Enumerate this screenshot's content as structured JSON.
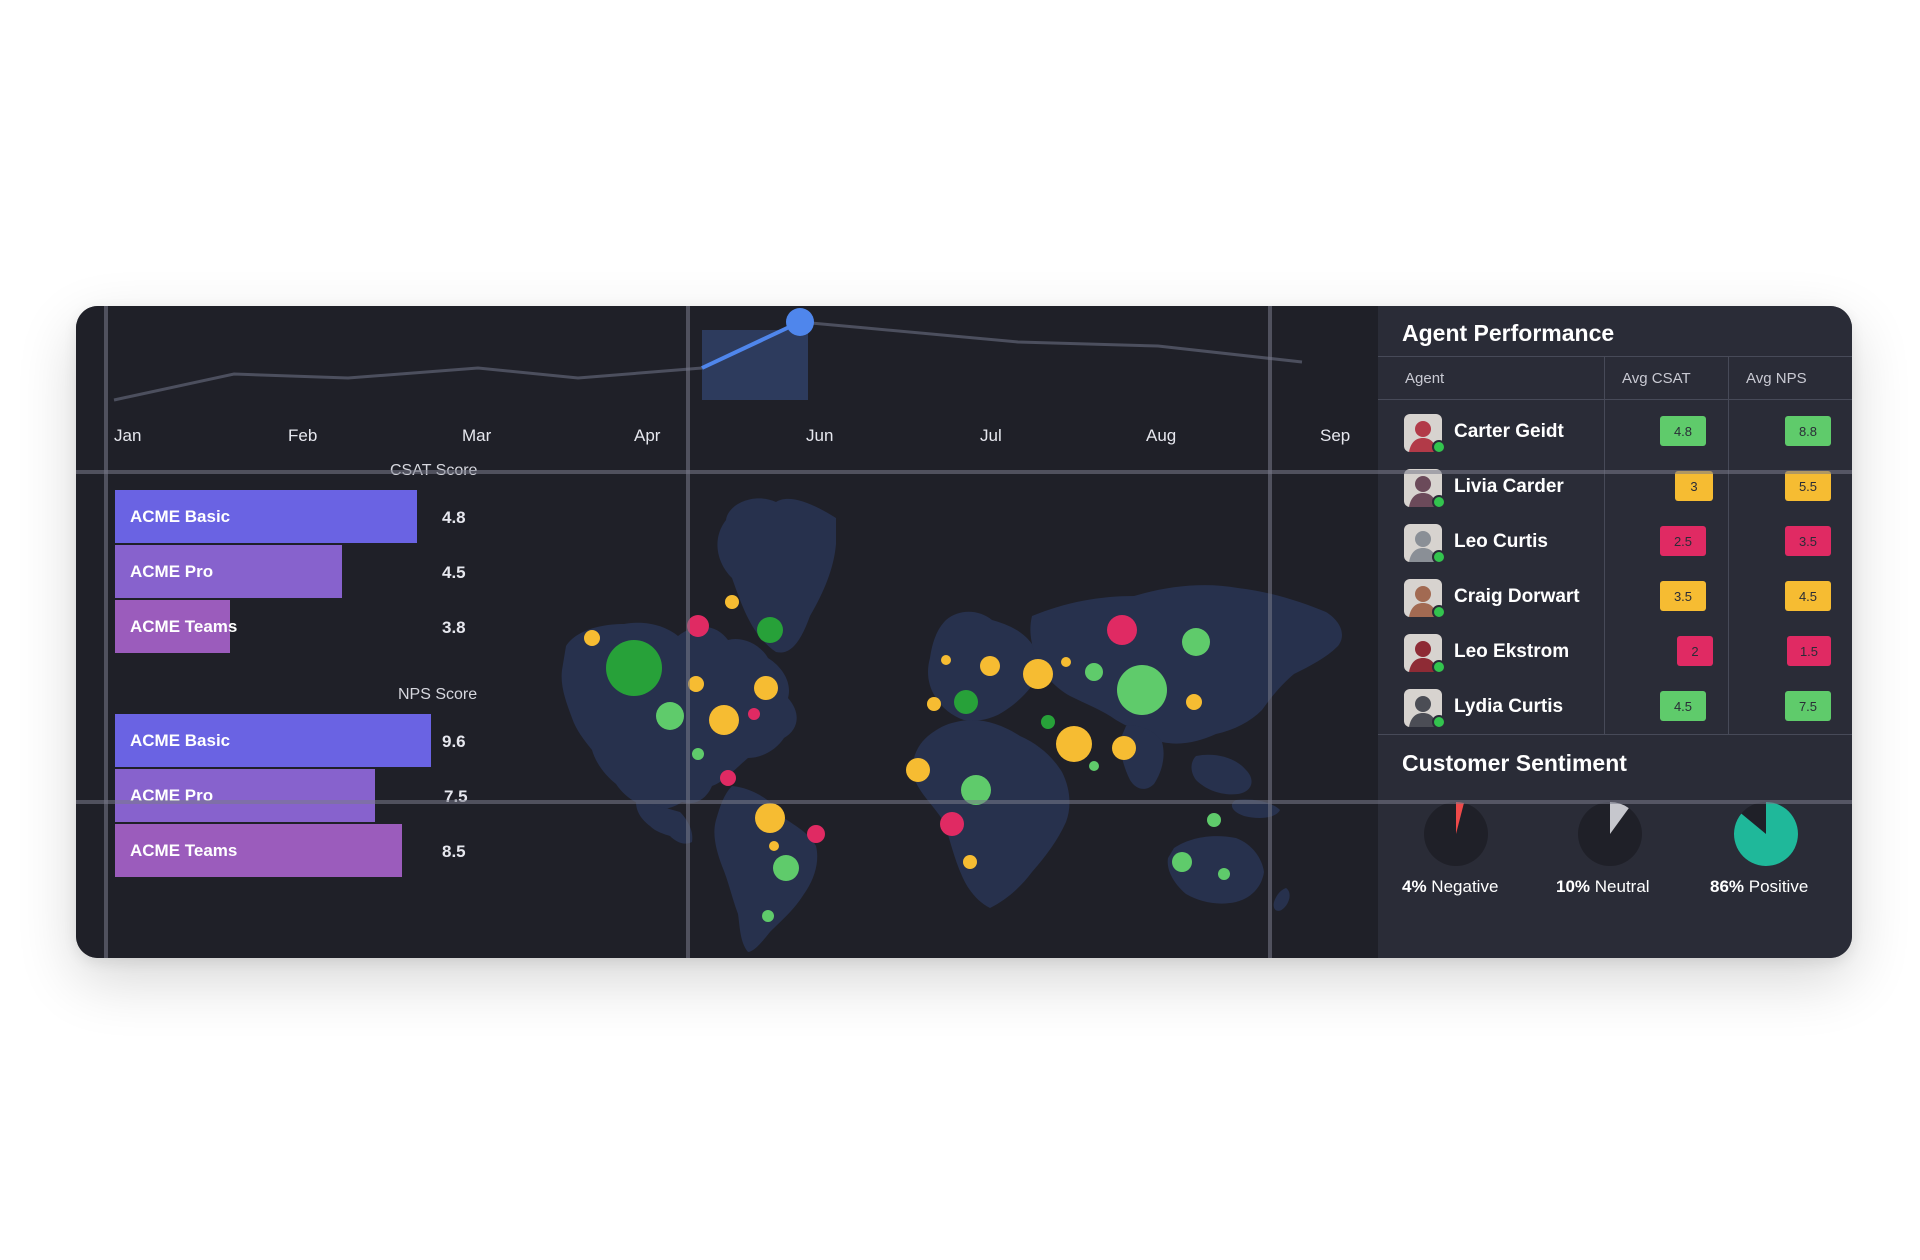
{
  "timeline": {
    "months": [
      "Jan",
      "Feb",
      "Mar",
      "Apr",
      "Jun",
      "Jul",
      "Aug",
      "Sep"
    ]
  },
  "csat_chart": {
    "title": "CSAT Score",
    "bars": [
      {
        "label": "ACME Basic",
        "value": "4.8",
        "color": "#6a63e3"
      },
      {
        "label": "ACME Pro",
        "value": "4.5",
        "color": "#8762cd"
      },
      {
        "label": "ACME Teams",
        "value": "3.8",
        "color": "#9b5cbc"
      }
    ]
  },
  "nps_chart": {
    "title": "NPS Score",
    "bars": [
      {
        "label": "ACME Basic",
        "value": "9.6",
        "color": "#6a63e3"
      },
      {
        "label": "ACME Pro",
        "value": "7.5",
        "color": "#8762cd"
      },
      {
        "label": "ACME Teams",
        "value": "8.5",
        "color": "#9b5cbc"
      }
    ]
  },
  "agent_performance": {
    "title": "Agent Performance",
    "columns": [
      "Agent",
      "Avg CSAT",
      "Avg NPS"
    ],
    "rows": [
      {
        "name": "Carter Geidt",
        "csat": "4.8",
        "csat_color": "#5fcb6b",
        "nps": "8.8",
        "nps_color": "#5fcb6b",
        "avatar_color": "#b23a48"
      },
      {
        "name": "Livia Carder",
        "csat": "3",
        "csat_color": "#f6bc32",
        "nps": "5.5",
        "nps_color": "#f6bc32",
        "avatar_color": "#6b4a5a"
      },
      {
        "name": "Leo Curtis",
        "csat": "2.5",
        "csat_color": "#e02a63",
        "nps": "3.5",
        "nps_color": "#e02a63",
        "avatar_color": "#8a8f96"
      },
      {
        "name": "Craig Dorwart",
        "csat": "3.5",
        "csat_color": "#f6bc32",
        "nps": "4.5",
        "nps_color": "#f6bc32",
        "avatar_color": "#a26a52"
      },
      {
        "name": "Leo Ekstrom",
        "csat": "2",
        "csat_color": "#e02a63",
        "nps": "1.5",
        "nps_color": "#e02a63",
        "avatar_color": "#8e2b35"
      },
      {
        "name": "Lydia Curtis",
        "csat": "4.5",
        "csat_color": "#5fcb6b",
        "nps": "7.5",
        "nps_color": "#5fcb6b",
        "avatar_color": "#4b4d55"
      }
    ]
  },
  "customer_sentiment": {
    "title": "Customer Sentiment",
    "items": [
      {
        "percent": "4%",
        "label": "Negative",
        "fraction": 0.04,
        "color": "#ef4a4a"
      },
      {
        "percent": "10%",
        "label": "Neutral",
        "fraction": 0.1,
        "color": "#c6c7cd"
      },
      {
        "percent": "86%",
        "label": "Positive",
        "fraction": 0.86,
        "color": "#1fb89a"
      }
    ]
  },
  "colors": {
    "background": "#1f2028",
    "panel": "#2a2c37",
    "land": "#27314d",
    "timeline_line": "#4c4f5e",
    "timeline_highlight": "#4f86ec"
  }
}
